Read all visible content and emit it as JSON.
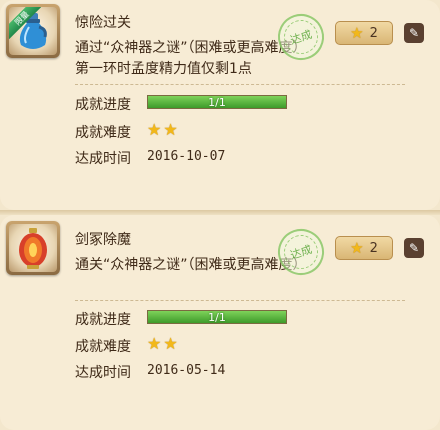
{
  "achievements": [
    {
      "title": "惊险过关",
      "description": "通过“众神器之谜”（困难或更高难度）第一环时孟度精力值仅剩1点",
      "badge": "限量",
      "icon": "blue-potion-icon",
      "stamp": "达成",
      "points": "2",
      "progress_label": "成就进度",
      "progress_text": "1/1",
      "progress_fraction": 1.0,
      "difficulty_label": "成就难度",
      "difficulty_stars": 2,
      "date_label": "达成时间",
      "date": "2016-10-07"
    },
    {
      "title": "剑冢除魔",
      "description": "通关“众神器之谜”（困难或更高难度）",
      "icon": "red-lantern-icon",
      "stamp": "达成",
      "points": "2",
      "progress_label": "成就进度",
      "progress_text": "1/1",
      "progress_fraction": 1.0,
      "difficulty_label": "成就难度",
      "difficulty_stars": 2,
      "date_label": "达成时间",
      "date": "2016-05-14"
    }
  ],
  "colors": {
    "background": "#f3e7cd",
    "progress_fill": "#3e9b2a",
    "star": "#f2b81a",
    "stamp": "#5aa83a"
  }
}
